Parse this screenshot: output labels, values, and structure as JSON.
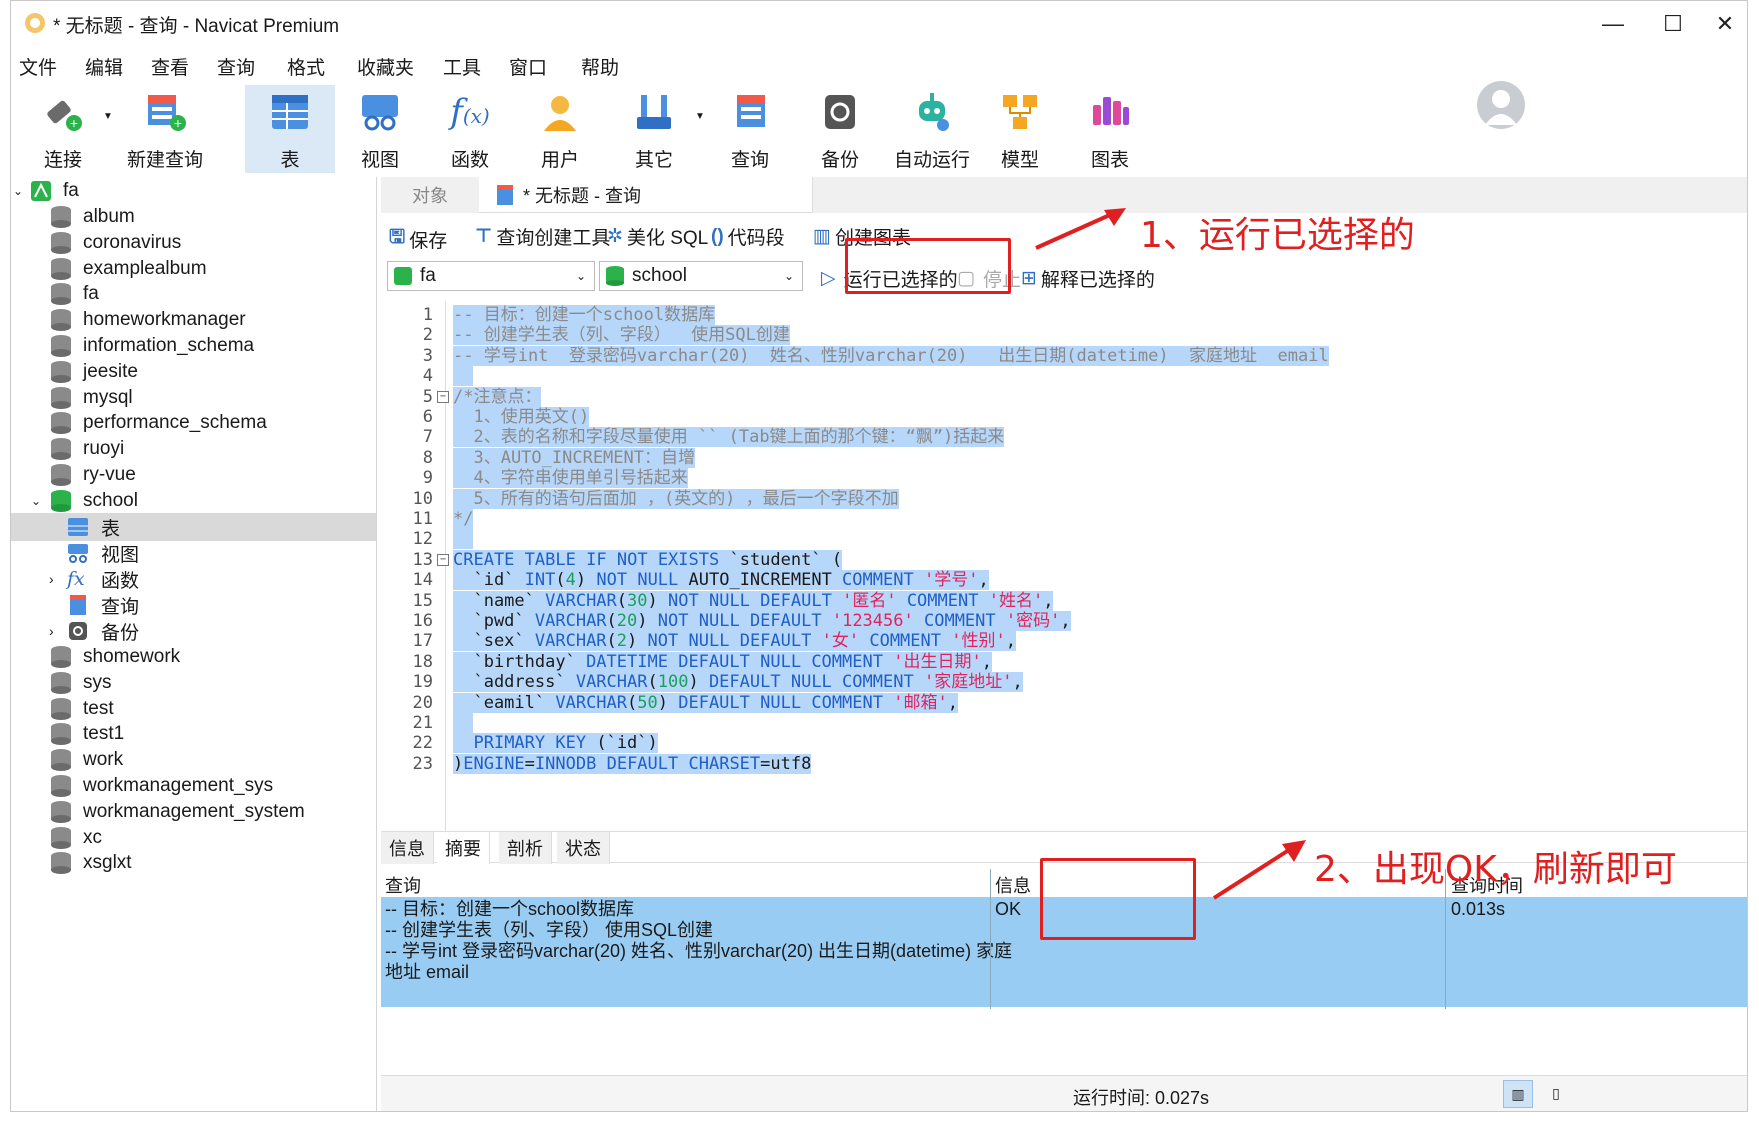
{
  "window": {
    "title": "* 无标题 - 查询 - Navicat Premium"
  },
  "menu": [
    "文件",
    "编辑",
    "查看",
    "查询",
    "格式",
    "收藏夹",
    "工具",
    "窗口",
    "帮助"
  ],
  "toolbar": {
    "connect": "连接",
    "new_query": "新建查询",
    "table": "表",
    "view": "视图",
    "function": "函数",
    "user": "用户",
    "other": "其它",
    "query": "查询",
    "backup": "备份",
    "auto_run": "自动运行",
    "model": "模型",
    "chart": "图表"
  },
  "sidebar": {
    "connection": "fa",
    "databases": [
      "album",
      "coronavirus",
      "examplealbum",
      "fa",
      "homeworkmanager",
      "information_schema",
      "jeesite",
      "mysql",
      "performance_schema",
      "ruoyi",
      "ry-vue"
    ],
    "open_db": "school",
    "school_children": [
      "表",
      "视图",
      "函数",
      "查询",
      "备份"
    ],
    "databases_after": [
      "shomework",
      "sys",
      "test",
      "test1",
      "work",
      "workmanagement_sys",
      "workmanagement_system",
      "xc",
      "xsglxt"
    ]
  },
  "tabs": {
    "objects": "对象",
    "query_tab": "* 无标题 - 查询"
  },
  "query_toolbar": {
    "save": "保存",
    "builder": "查询创建工具",
    "beautify": "美化 SQL",
    "snippet": "代码段",
    "create_chart": "创建图表"
  },
  "selectors": {
    "connection": "fa",
    "database": "school",
    "run_selected": "运行已选择的",
    "stop": "停止",
    "explain_selected": "解释已选择的"
  },
  "editor_lines": [
    "-- 目标：创建一个school数据库",
    "-- 创建学生表（列、字段）  使用SQL创建",
    "-- 学号int  登录密码varchar(20)  姓名、性别varchar(20)   出生日期(datetime)  家庭地址  email",
    "",
    "/*注意点：",
    "  1、使用英文()",
    "  2、表的名称和字段尽量使用 `` (Tab键上面的那个键：“飘”)括起来",
    "  3、AUTO_INCREMENT：自增",
    "  4、字符串使用单引号括起来",
    "  5、所有的语句后面加 ，(英文的) ，最后一个字段不加",
    "*/",
    "",
    "CREATE TABLE IF NOT EXISTS `student` (",
    "  `id` INT(4) NOT NULL AUTO_INCREMENT COMMENT '学号',",
    "  `name` VARCHAR(30) NOT NULL DEFAULT '匿名' COMMENT '姓名',",
    "  `pwd` VARCHAR(20) NOT NULL DEFAULT '123456' COMMENT '密码',",
    "  `sex` VARCHAR(2) NOT NULL DEFAULT '女' COMMENT '性别',",
    "  `birthday` DATETIME DEFAULT NULL COMMENT '出生日期',",
    "  `address` VARCHAR(100) DEFAULT NULL COMMENT '家庭地址',",
    "  `eamil` VARCHAR(50) DEFAULT NULL COMMENT '邮箱',",
    "",
    "  PRIMARY KEY (`id`)",
    ")ENGINE=INNODB DEFAULT CHARSET=utf8"
  ],
  "result_tabs": [
    "信息",
    "摘要",
    "剖析",
    "状态"
  ],
  "result_grid": {
    "headers": {
      "query": "查询",
      "info": "信息",
      "time": "查询时间"
    },
    "row": {
      "query_lines": [
        "-- 目标：创建一个school数据库",
        "-- 创建学生表（列、字段）  使用SQL创建",
        "-- 学号int  登录密码varchar(20)  姓名、性别varchar(20)   出生日期(datetime)  家庭",
        "地址  email"
      ],
      "info": "OK",
      "time": "0.013s"
    }
  },
  "status": {
    "run_time": "运行时间: 0.027s"
  },
  "annotations": {
    "note1": "1、运行已选择的",
    "note2": "2、出现OK，刷新即可"
  },
  "colors": {
    "selection": "#b7d7fa",
    "result_row": "#99ccf3",
    "annotation": "#e02020",
    "keyword": "#1f5fc7",
    "string": "#e0245e",
    "comment": "#8a8a8a"
  }
}
